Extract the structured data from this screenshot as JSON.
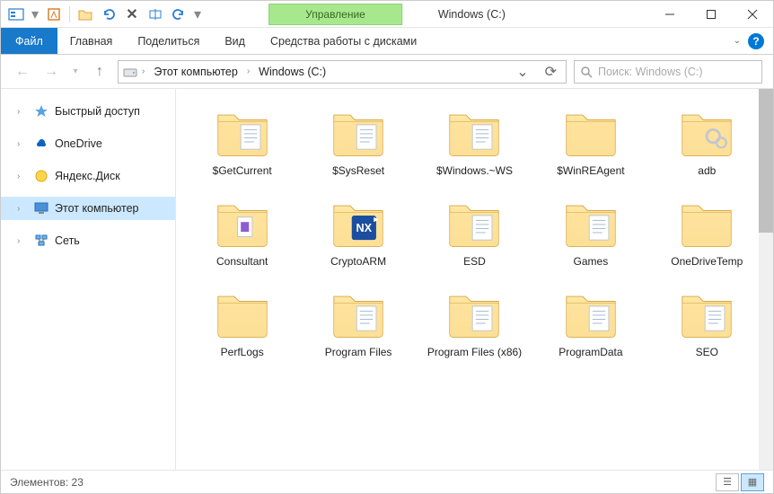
{
  "title": "Windows (C:)",
  "manage": "Управление",
  "ribbon": {
    "file": "Файл",
    "home": "Главная",
    "share": "Поделиться",
    "view": "Вид",
    "tools": "Средства работы с дисками"
  },
  "breadcrumb": {
    "level1": "Этот компьютер",
    "level2": "Windows (C:)"
  },
  "search": {
    "placeholder": "Поиск: Windows (C:)"
  },
  "nav": {
    "quick": "Быстрый доступ",
    "onedrive": "OneDrive",
    "yandex": "Яндекс.Диск",
    "thispc": "Этот компьютер",
    "network": "Сеть"
  },
  "items": [
    {
      "name": "$GetCurrent",
      "type": "folder-docs"
    },
    {
      "name": "$SysReset",
      "type": "folder-docs"
    },
    {
      "name": "$Windows.~WS",
      "type": "folder-docs"
    },
    {
      "name": "$WinREAgent",
      "type": "folder"
    },
    {
      "name": "adb",
      "type": "folder-gears"
    },
    {
      "name": "Consultant",
      "type": "folder-doc"
    },
    {
      "name": "CryptoARM",
      "type": "folder-nx"
    },
    {
      "name": "ESD",
      "type": "folder-docs"
    },
    {
      "name": "Games",
      "type": "folder-docs"
    },
    {
      "name": "OneDriveTemp",
      "type": "folder"
    },
    {
      "name": "PerfLogs",
      "type": "folder"
    },
    {
      "name": "Program Files",
      "type": "folder-docs"
    },
    {
      "name": "Program Files (x86)",
      "type": "folder-docs"
    },
    {
      "name": "ProgramData",
      "type": "folder-docs"
    },
    {
      "name": "SEO",
      "type": "folder-docs"
    }
  ],
  "status": {
    "count_label": "Элементов:",
    "count": "23"
  }
}
